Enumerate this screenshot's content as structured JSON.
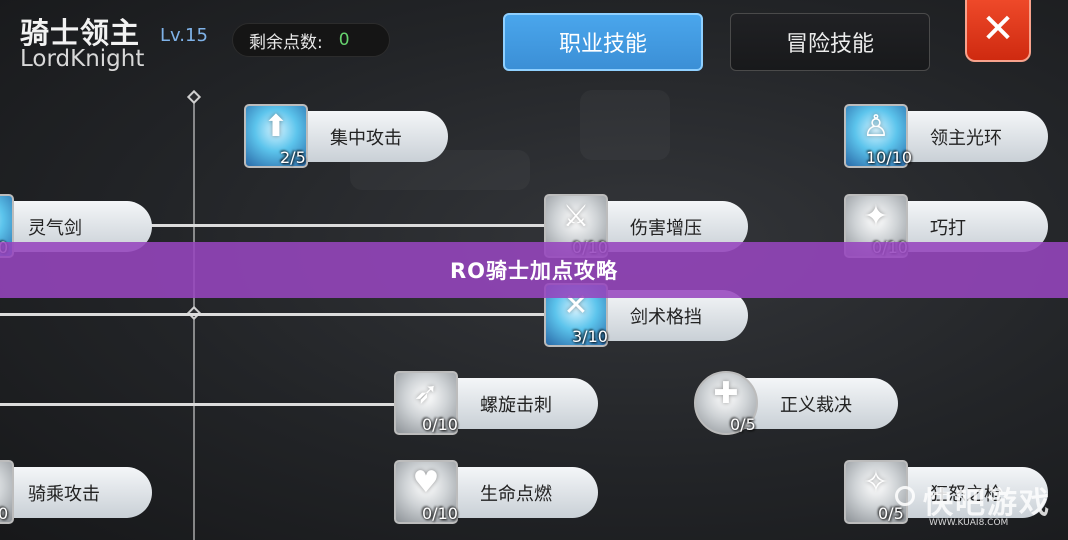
{
  "header": {
    "title_cn": "骑士领主",
    "title_en": "LordKnight",
    "level": "Lv.15",
    "points_label": "剩余点数:",
    "points_value": "0"
  },
  "tabs": [
    {
      "label": "职业技能",
      "active": true
    },
    {
      "label": "冒险技能",
      "active": false
    }
  ],
  "close_label": "✕",
  "skills": {
    "focus_attack": {
      "name": "集中攻击",
      "level": "2/5",
      "icon": "focus-attack-icon"
    },
    "lord_aura": {
      "name": "领主光环",
      "level": "10/10",
      "icon": "lord-aura-icon"
    },
    "spirit_sword": {
      "name": "灵气剑",
      "level": "0",
      "icon": "spirit-sword-icon"
    },
    "damage_press": {
      "name": "伤害增压",
      "level": "0/10",
      "icon": "damage-press-icon"
    },
    "skill_strike": {
      "name": "巧打",
      "level": "0/10",
      "icon": "skill-strike-icon"
    },
    "sword_parry": {
      "name": "剑术格挡",
      "level": "3/10",
      "icon": "sword-parry-icon"
    },
    "spiral_pierce": {
      "name": "螺旋击刺",
      "level": "0/10",
      "icon": "spiral-pierce-icon"
    },
    "justice_judgment": {
      "name": "正义裁决",
      "level": "0/5",
      "icon": "justice-judgment-icon"
    },
    "mounted_attack": {
      "name": "骑乘攻击",
      "level": "0",
      "icon": "mounted-attack-icon"
    },
    "life_burn": {
      "name": "生命点燃",
      "level": "0/10",
      "icon": "life-burn-icon"
    },
    "fierce_spear": {
      "name": "狂怒之枪",
      "level": "0/5",
      "icon": "fierce-spear-icon"
    }
  },
  "banner": "RO骑士加点攻略",
  "watermark": {
    "name": "快吧游戏",
    "url": "WWW.KUAI8.COM"
  },
  "colors": {
    "accent": "#3b8fd6",
    "banner": "#9646be",
    "close": "#d9321a",
    "points": "#66d36e"
  }
}
